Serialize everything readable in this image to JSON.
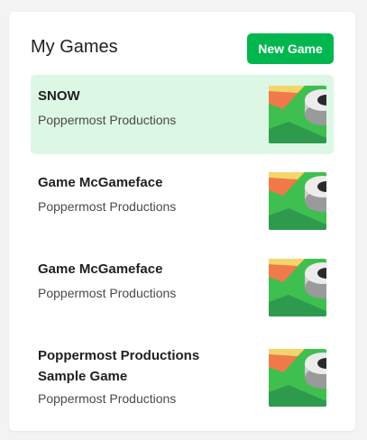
{
  "header": {
    "title": "My Games",
    "new_game_label": "New Game"
  },
  "games": [
    {
      "name": "SNOW",
      "studio": "Poppermost Productions",
      "selected": true,
      "thumbnail_icon": "game-thumbnail-icon"
    },
    {
      "name": "Game McGameface",
      "studio": "Poppermost Productions",
      "selected": false,
      "thumbnail_icon": "game-thumbnail-icon"
    },
    {
      "name": "Game McGameface",
      "studio": "Poppermost Productions",
      "selected": false,
      "thumbnail_icon": "game-thumbnail-icon"
    },
    {
      "name": "Poppermost Productions Sample Game",
      "studio": "Poppermost Productions",
      "selected": false,
      "thumbnail_icon": "game-thumbnail-icon"
    }
  ],
  "colors": {
    "accent": "#00b74f",
    "selected_bg": "#dcf8e4",
    "thumb_green": "#3fbf4f",
    "thumb_dark_green": "#2e9a4e",
    "thumb_orange": "#f07a4a",
    "thumb_yellow": "#f3d66a"
  }
}
